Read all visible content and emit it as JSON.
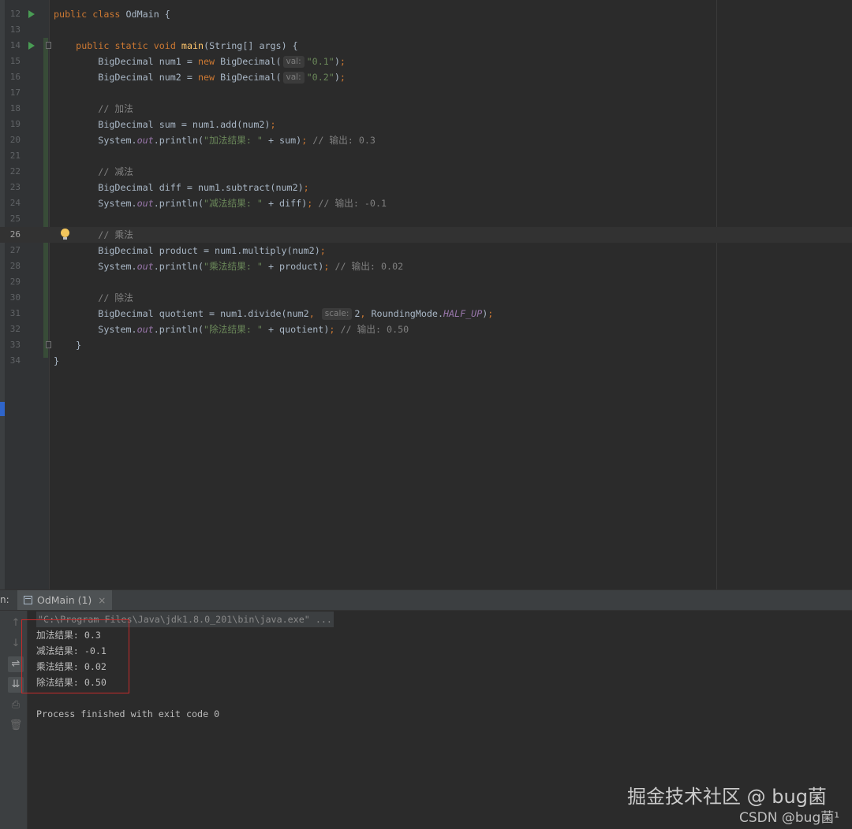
{
  "editor": {
    "lines": [
      {
        "num": "12",
        "tokens": [
          {
            "t": "public",
            "c": "kw"
          },
          {
            "t": " "
          },
          {
            "t": "class",
            "c": "kw"
          },
          {
            "t": " OdMain {"
          }
        ]
      },
      {
        "num": "13",
        "tokens": []
      },
      {
        "num": "14",
        "tokens": [
          {
            "t": "    "
          },
          {
            "t": "public",
            "c": "kw"
          },
          {
            "t": " "
          },
          {
            "t": "static",
            "c": "kw"
          },
          {
            "t": " "
          },
          {
            "t": "void",
            "c": "kw"
          },
          {
            "t": " "
          },
          {
            "t": "main",
            "c": "fn"
          },
          {
            "t": "(String[] args) {"
          }
        ]
      },
      {
        "num": "15",
        "tokens": [
          {
            "t": "        BigDecimal num1 = "
          },
          {
            "t": "new",
            "c": "kw"
          },
          {
            "t": " BigDecimal("
          },
          {
            "t": "val:",
            "c": "hint"
          },
          {
            "t": "\"0.1\"",
            "c": "str"
          },
          {
            "t": ")"
          },
          {
            "t": ";",
            "c": "kw"
          }
        ]
      },
      {
        "num": "16",
        "tokens": [
          {
            "t": "        BigDecimal num2 = "
          },
          {
            "t": "new",
            "c": "kw"
          },
          {
            "t": " BigDecimal("
          },
          {
            "t": "val:",
            "c": "hint"
          },
          {
            "t": "\"0.2\"",
            "c": "str"
          },
          {
            "t": ")"
          },
          {
            "t": ";",
            "c": "kw"
          }
        ]
      },
      {
        "num": "17",
        "tokens": []
      },
      {
        "num": "18",
        "tokens": [
          {
            "t": "        "
          },
          {
            "t": "// 加法",
            "c": "cm"
          }
        ]
      },
      {
        "num": "19",
        "tokens": [
          {
            "t": "        BigDecimal sum = num1.add(num2)"
          },
          {
            "t": ";",
            "c": "kw"
          }
        ]
      },
      {
        "num": "20",
        "tokens": [
          {
            "t": "        System."
          },
          {
            "t": "out",
            "c": "fld"
          },
          {
            "t": ".println("
          },
          {
            "t": "\"加法结果: \"",
            "c": "str"
          },
          {
            "t": " + sum)"
          },
          {
            "t": ";",
            "c": "kw"
          },
          {
            "t": " "
          },
          {
            "t": "// 输出: 0.3",
            "c": "cm"
          }
        ]
      },
      {
        "num": "21",
        "tokens": []
      },
      {
        "num": "22",
        "tokens": [
          {
            "t": "        "
          },
          {
            "t": "// 减法",
            "c": "cm"
          }
        ]
      },
      {
        "num": "23",
        "tokens": [
          {
            "t": "        BigDecimal diff = num1.subtract(num2)"
          },
          {
            "t": ";",
            "c": "kw"
          }
        ]
      },
      {
        "num": "24",
        "tokens": [
          {
            "t": "        System."
          },
          {
            "t": "out",
            "c": "fld"
          },
          {
            "t": ".println("
          },
          {
            "t": "\"减法结果: \"",
            "c": "str"
          },
          {
            "t": " + diff)"
          },
          {
            "t": ";",
            "c": "kw"
          },
          {
            "t": " "
          },
          {
            "t": "// 输出: -0.1",
            "c": "cm"
          }
        ]
      },
      {
        "num": "25",
        "tokens": []
      },
      {
        "num": "26",
        "tokens": [
          {
            "t": "        "
          },
          {
            "t": "// 乘法",
            "c": "cm"
          }
        ]
      },
      {
        "num": "27",
        "tokens": [
          {
            "t": "        BigDecimal product = num1.multiply(num2)"
          },
          {
            "t": ";",
            "c": "kw"
          }
        ]
      },
      {
        "num": "28",
        "tokens": [
          {
            "t": "        System."
          },
          {
            "t": "out",
            "c": "fld"
          },
          {
            "t": ".println("
          },
          {
            "t": "\"乘法结果: \"",
            "c": "str"
          },
          {
            "t": " + product)"
          },
          {
            "t": ";",
            "c": "kw"
          },
          {
            "t": " "
          },
          {
            "t": "// 输出: 0.02",
            "c": "cm"
          }
        ]
      },
      {
        "num": "29",
        "tokens": []
      },
      {
        "num": "30",
        "tokens": [
          {
            "t": "        "
          },
          {
            "t": "// 除法",
            "c": "cm"
          }
        ]
      },
      {
        "num": "31",
        "tokens": [
          {
            "t": "        BigDecimal quotient = num1.divide(num2"
          },
          {
            "t": ",",
            "c": "kw"
          },
          {
            "t": " "
          },
          {
            "t": "scale:",
            "c": "hint"
          },
          {
            "t": "2"
          },
          {
            "t": ",",
            "c": "kw"
          },
          {
            "t": " RoundingMode."
          },
          {
            "t": "HALF_UP",
            "c": "fld"
          },
          {
            "t": ")"
          },
          {
            "t": ";",
            "c": "kw"
          }
        ]
      },
      {
        "num": "32",
        "tokens": [
          {
            "t": "        System."
          },
          {
            "t": "out",
            "c": "fld"
          },
          {
            "t": ".println("
          },
          {
            "t": "\"除法结果: \"",
            "c": "str"
          },
          {
            "t": " + quotient)"
          },
          {
            "t": ";",
            "c": "kw"
          },
          {
            "t": " "
          },
          {
            "t": "// 输出: 0.50",
            "c": "cm"
          }
        ]
      },
      {
        "num": "33",
        "tokens": [
          {
            "t": "    }"
          }
        ]
      },
      {
        "num": "34",
        "tokens": [
          {
            "t": "}"
          }
        ]
      }
    ],
    "current_line": "26",
    "run_gutter_lines": [
      "12",
      "14"
    ],
    "fold_lines": [
      "14",
      "33"
    ],
    "bulb_line": "26"
  },
  "run_panel": {
    "prefix": "n:",
    "tab_label": "OdMain (1)",
    "tab_close": "×",
    "toolbar": [
      {
        "name": "up-arrow-icon",
        "glyph": "↑",
        "active": false
      },
      {
        "name": "down-arrow-icon",
        "glyph": "↓",
        "active": false
      },
      {
        "name": "soft-wrap-icon",
        "glyph": "⇌",
        "active": true
      },
      {
        "name": "scroll-to-end-icon",
        "glyph": "⇊",
        "active": true
      },
      {
        "name": "print-icon",
        "glyph": "⎙",
        "active": false
      },
      {
        "name": "trash-icon",
        "glyph": "🗑",
        "active": false
      }
    ],
    "console_lines": [
      "\"C:\\Program Files\\Java\\jdk1.8.0_201\\bin\\java.exe\" ...",
      "加法结果: 0.3",
      "减法结果: -0.1",
      "乘法结果: 0.02",
      "除法结果: 0.50",
      "",
      "Process finished with exit code 0"
    ]
  },
  "watermark": {
    "line1": "掘金技术社区 @ bug菌",
    "line2": "CSDN @bug菌¹"
  },
  "colors": {
    "keyword": "#cc7832",
    "method": "#ffc66d",
    "string": "#6a8759",
    "comment": "#808080",
    "field": "#9876aa",
    "highlight_box": "#c42b2b"
  }
}
